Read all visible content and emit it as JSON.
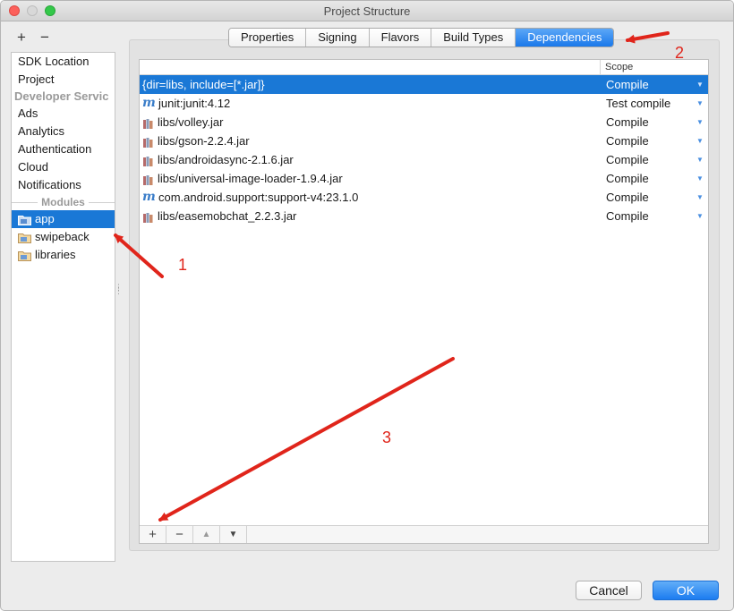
{
  "window": {
    "title": "Project Structure"
  },
  "sidebar": {
    "tools": {
      "add": "+",
      "remove": "−"
    },
    "items": [
      {
        "label": "SDK Location"
      },
      {
        "label": "Project"
      }
    ],
    "developer_header": "Developer Servic",
    "developer_items": [
      {
        "label": "Ads"
      },
      {
        "label": "Analytics"
      },
      {
        "label": "Authentication"
      },
      {
        "label": "Cloud"
      },
      {
        "label": "Notifications"
      }
    ],
    "modules_header": "Modules",
    "modules": [
      {
        "label": "app",
        "selected": true
      },
      {
        "label": "swipeback"
      },
      {
        "label": "libraries"
      }
    ]
  },
  "tabs": [
    {
      "label": "Properties"
    },
    {
      "label": "Signing"
    },
    {
      "label": "Flavors"
    },
    {
      "label": "Build Types"
    },
    {
      "label": "Dependencies",
      "active": true
    }
  ],
  "table": {
    "scope_header": "Scope",
    "rows": [
      {
        "name": "{dir=libs, include=[*.jar]}",
        "scope": "Compile",
        "icon": "none",
        "selected": true
      },
      {
        "name": "junit:junit:4.12",
        "scope": "Test compile",
        "icon": "maven-icon"
      },
      {
        "name": "libs/volley.jar",
        "scope": "Compile",
        "icon": "jar-icon"
      },
      {
        "name": "libs/gson-2.2.4.jar",
        "scope": "Compile",
        "icon": "jar-icon"
      },
      {
        "name": "libs/androidasync-2.1.6.jar",
        "scope": "Compile",
        "icon": "jar-icon"
      },
      {
        "name": "libs/universal-image-loader-1.9.4.jar",
        "scope": "Compile",
        "icon": "jar-icon"
      },
      {
        "name": "com.android.support:support-v4:23.1.0",
        "scope": "Compile",
        "icon": "maven-icon"
      },
      {
        "name": "libs/easemobchat_2.2.3.jar",
        "scope": "Compile",
        "icon": "jar-icon"
      }
    ],
    "toolbar": {
      "add": "+",
      "remove": "−",
      "up": "▲",
      "down": "▼"
    }
  },
  "buttons": {
    "cancel": "Cancel",
    "ok": "OK"
  },
  "annotations": {
    "one": "1",
    "two": "2",
    "three": "3"
  },
  "colors": {
    "selection": "#1a78d6",
    "annotation": "#e0251b"
  }
}
